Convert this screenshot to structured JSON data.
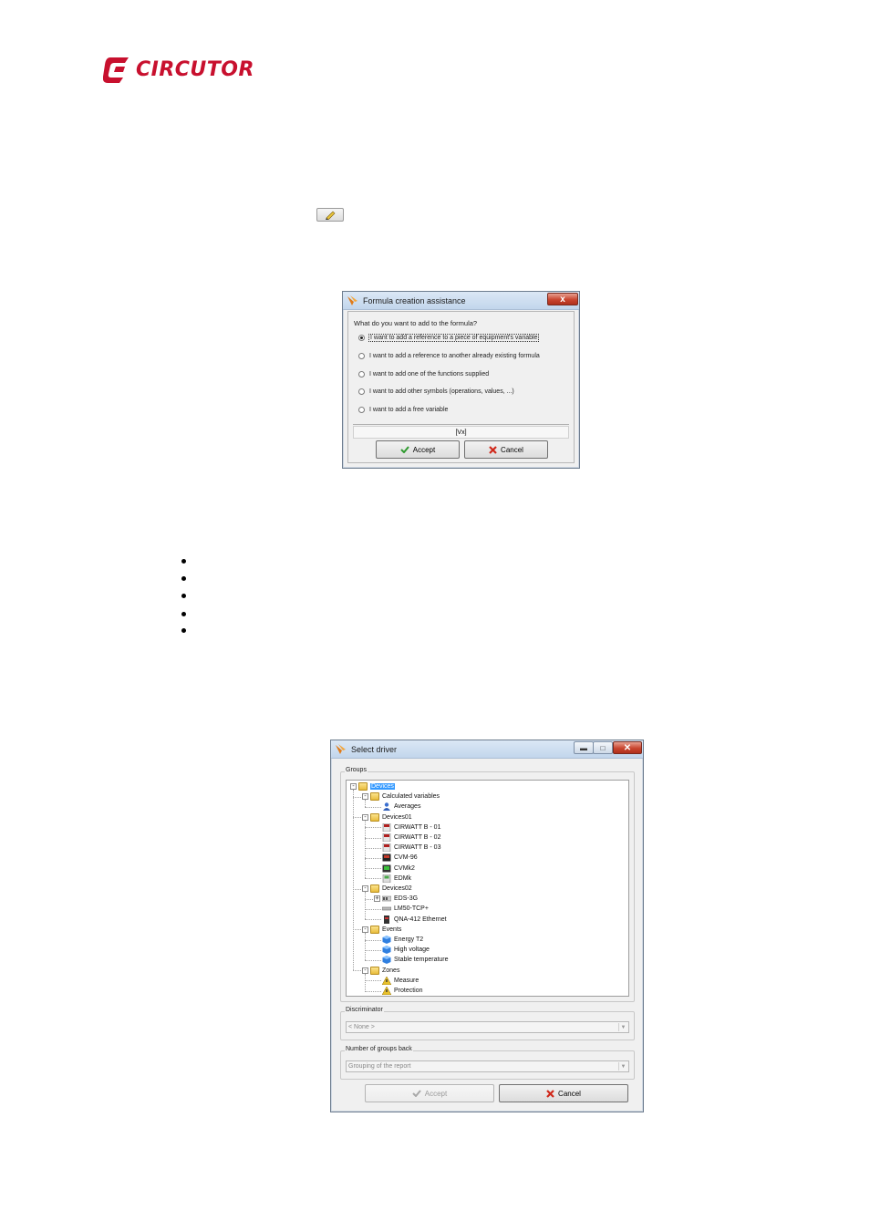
{
  "logo": {
    "text": "CIRCUTOR"
  },
  "formula_dialog": {
    "title": "Formula creation assistance",
    "close_label": "x",
    "question": "What do you want to add to the formula?",
    "options": [
      {
        "label": "I want to add a reference to a piece of equipment's variable",
        "selected": true
      },
      {
        "label": "I want to add a reference to another already existing formula",
        "selected": false
      },
      {
        "label": "I want to add one of the functions supplied",
        "selected": false
      },
      {
        "label": "I want to add other symbols (operations, values, ...)",
        "selected": false
      },
      {
        "label": "I want to add a free variable",
        "selected": false
      }
    ],
    "formula_preview": "[Vx]",
    "accept_label": "Accept",
    "cancel_label": "Cancel"
  },
  "driver_dialog": {
    "title": "Select driver",
    "groups_label": "Groups",
    "tree": [
      {
        "label": "Devices",
        "level": 0,
        "expander": "-",
        "icon": "folder",
        "selected": true
      },
      {
        "label": "Calculated variables",
        "level": 1,
        "expander": "-",
        "icon": "folder"
      },
      {
        "label": "Averages",
        "level": 2,
        "icon": "user"
      },
      {
        "label": "Devices01",
        "level": 1,
        "expander": "-",
        "icon": "folder"
      },
      {
        "label": "CIRWATT B - 01",
        "level": 2,
        "icon": "meter"
      },
      {
        "label": "CIRWATT B - 02",
        "level": 2,
        "icon": "meter"
      },
      {
        "label": "CIRWATT B - 03",
        "level": 2,
        "icon": "meter"
      },
      {
        "label": "CVM-96",
        "level": 2,
        "icon": "analyzer-dark"
      },
      {
        "label": "CVMk2",
        "level": 2,
        "icon": "analyzer-green"
      },
      {
        "label": "EDMk",
        "level": 2,
        "icon": "edmk"
      },
      {
        "label": "Devices02",
        "level": 1,
        "expander": "-",
        "icon": "folder"
      },
      {
        "label": "EDS-3G",
        "level": 2,
        "expander": "+",
        "icon": "eds"
      },
      {
        "label": "LM50-TCP+",
        "level": 2,
        "icon": "lm50"
      },
      {
        "label": "QNA-412 Ethernet",
        "level": 2,
        "icon": "qna"
      },
      {
        "label": "Events",
        "level": 1,
        "expander": "-",
        "icon": "folder"
      },
      {
        "label": "Energy T2",
        "level": 2,
        "icon": "cube"
      },
      {
        "label": "High voltage",
        "level": 2,
        "icon": "cube"
      },
      {
        "label": "Stable temperature",
        "level": 2,
        "icon": "cube"
      },
      {
        "label": "Zones",
        "level": 1,
        "expander": "-",
        "icon": "folder"
      },
      {
        "label": "Measure",
        "level": 2,
        "icon": "zone"
      },
      {
        "label": "Protection",
        "level": 2,
        "icon": "zone"
      }
    ],
    "discriminator_label": "Discriminator",
    "discriminator_value": "< None >",
    "groups_back_label": "Number of groups back",
    "groups_back_value": "Grouping of the report",
    "accept_label": "Accept",
    "cancel_label": "Cancel"
  },
  "bullet_count": 5
}
